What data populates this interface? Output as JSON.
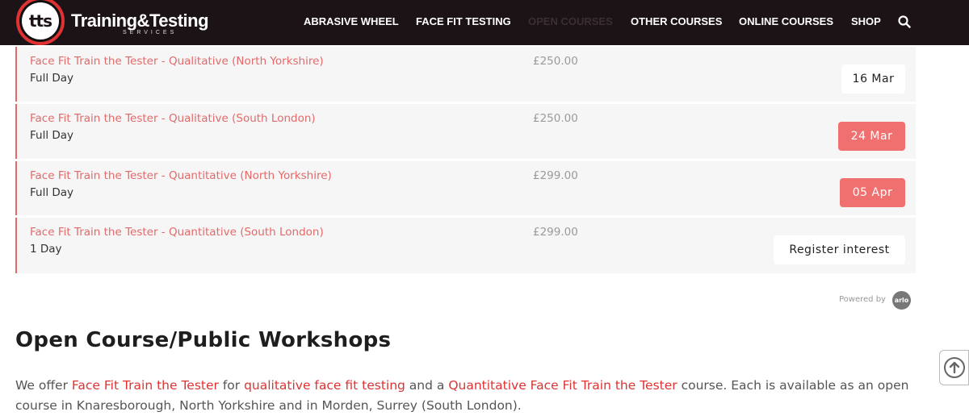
{
  "header": {
    "brand": "Training&Testing",
    "brand_sub": "SERVICES",
    "logo_text": "tts",
    "nav": [
      {
        "label": "ABRASIVE WHEEL"
      },
      {
        "label": "FACE FIT TESTING"
      },
      {
        "label": "OPEN COURSES"
      },
      {
        "label": "OTHER COURSES"
      },
      {
        "label": "ONLINE COURSES"
      },
      {
        "label": "SHOP"
      }
    ],
    "search_icon": "search-icon"
  },
  "courses": [
    {
      "title": "Face Fit Train the Tester - Qualitative (North Yorkshire)",
      "duration": "Full Day",
      "price": "£250.00",
      "action": "16 Mar",
      "style": "white"
    },
    {
      "title": "Face Fit Train the Tester - Qualitative (South London)",
      "duration": "Full Day",
      "price": "£250.00",
      "action": "24 Mar",
      "style": "red"
    },
    {
      "title": "Face Fit Train the Tester - Quantitative (North Yorkshire)",
      "duration": "Full Day",
      "price": "£299.00",
      "action": "05 Apr",
      "style": "red"
    },
    {
      "title": "Face Fit Train the Tester - Quantitative (South London)",
      "duration": "1 Day",
      "price": "£299.00",
      "action": "Register interest",
      "style": "white"
    }
  ],
  "powered_by": "Powered by",
  "arlo_logo": "arlo",
  "section": {
    "title": "Open Course/Public Workshops",
    "para_1": "We offer ",
    "link_1": "Face Fit Train the Tester",
    "para_2": " for ",
    "link_2": "qualitative face fit testing",
    "para_3": " and a ",
    "link_3": "Quantitative Face Fit Train the Tester",
    "para_4": " course. Each is available as an open course in Knaresborough, North Yorkshire and in Morden, Surrey (South London)."
  },
  "colors": {
    "header_bg": "#1c1317",
    "accent": "#e36a6a",
    "button_red": "#f07070"
  }
}
